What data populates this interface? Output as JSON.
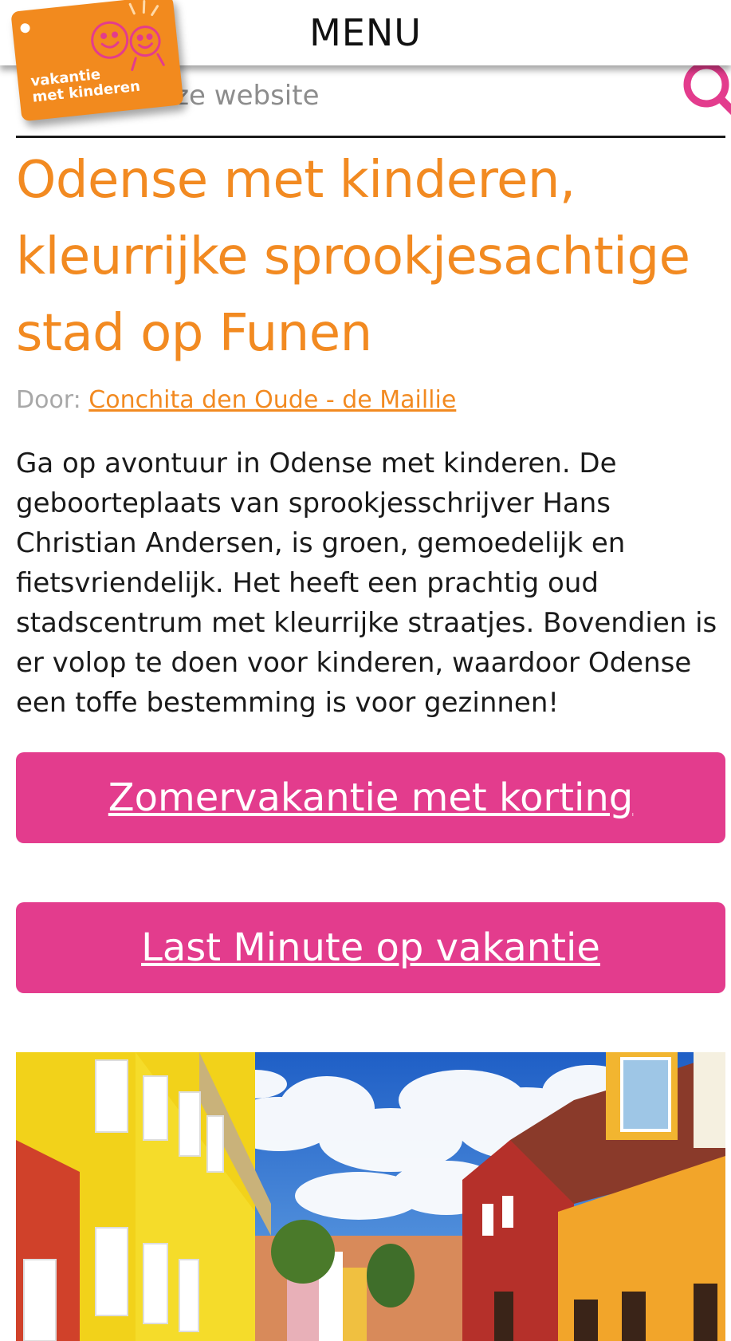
{
  "header": {
    "menu_label": "MENU"
  },
  "logo": {
    "line1": "vakantie",
    "line2": "met kinderen",
    "icon": "kids-smiley-logo"
  },
  "search": {
    "placeholder": "Zoek op deze website",
    "icon": "search-icon"
  },
  "article": {
    "title": "Odense met kinderen, kleurrijke sprookjesachtige stad op Funen",
    "byline_prefix": "Door:",
    "author": "Conchita den Oude - de Maillie",
    "intro": "Ga op avontuur in Odense met kinderen. De geboorteplaats van sprookjesschrijver Hans Christian Andersen, is groen, gemoedelijk en fietsvriendelijk. Het heeft een prachtig oud stadscentrum met kleurrijke straatjes. Bovendien is er volop te doen voor kinderen, waardoor Odense een toffe bestemming is voor gezinnen!"
  },
  "buttons": {
    "summer": "Zomervakantie met korting",
    "lastminute": "Last Minute op vakantie"
  },
  "colors": {
    "accent_orange": "#f28a21",
    "button_pink": "#e33c8d",
    "search_pink": "#e33c8d"
  }
}
